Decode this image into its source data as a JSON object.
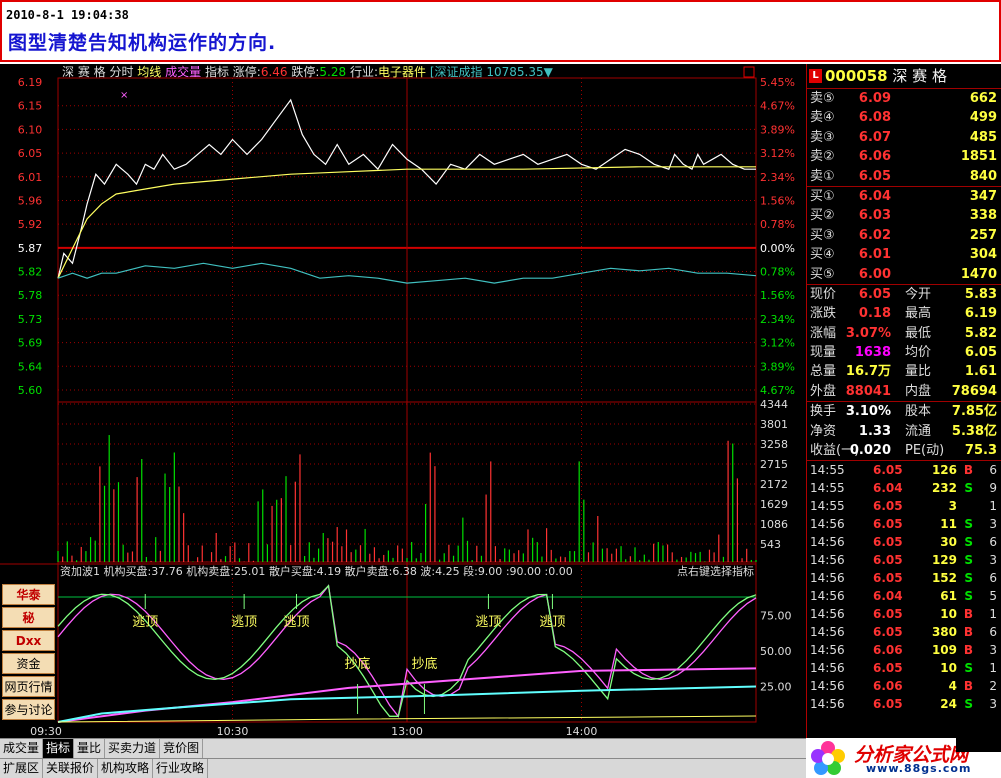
{
  "header": {
    "datetime": "2010-8-1 19:04:38",
    "caption": "图型清楚告知机构运作的方向."
  },
  "chart_header": {
    "stock_name": "深 赛 格",
    "modes": [
      "分时",
      "均线",
      "成交量",
      "指标"
    ],
    "limit_up_label": "涨停:",
    "limit_up_value": "6.46",
    "limit_down_label": "跌停:",
    "limit_down_value": "5.28",
    "industry_label": "行业:",
    "industry_value": "电子器件",
    "index_name": "[深证成指",
    "index_value": "10785.35",
    "index_arrow": "▼"
  },
  "chart_data": [
    {
      "type": "line",
      "title": "分时",
      "x_ticks": [
        "09:30",
        "10:30",
        "13:00",
        "14:00"
      ],
      "y_left": [
        "6.19",
        "6.15",
        "6.10",
        "6.05",
        "6.01",
        "5.96",
        "5.92",
        "5.87",
        "5.82",
        "5.78",
        "5.73",
        "5.69",
        "5.64",
        "5.60"
      ],
      "y_right": [
        "5.45%",
        "4.67%",
        "3.89%",
        "3.12%",
        "2.34%",
        "1.56%",
        "0.78%",
        "0.00%",
        "0.78%",
        "1.56%",
        "2.34%",
        "3.12%",
        "3.89%",
        "4.67%"
      ],
      "prev_close": 5.87,
      "ylim": [
        5.58,
        6.21
      ],
      "series": [
        {
          "name": "price",
          "color": "#ffffff",
          "x": [
            0,
            2,
            5,
            8,
            10,
            13,
            16,
            20,
            24,
            27,
            30,
            33,
            36,
            40,
            44,
            48,
            52,
            56,
            60,
            65,
            70,
            75,
            80,
            84,
            88,
            92,
            96,
            100,
            105,
            110,
            115,
            120,
            125,
            130,
            135,
            140,
            145,
            150,
            155,
            160,
            165,
            170,
            175,
            180,
            185,
            190,
            195,
            200,
            205,
            210,
            212,
            215,
            218,
            220,
            222,
            225,
            228,
            232,
            236,
            240
          ],
          "y": [
            5.83,
            5.88,
            5.86,
            5.93,
            5.98,
            6.04,
            6.02,
            6.06,
            6.04,
            6.02,
            6.06,
            6.05,
            6.08,
            6.05,
            6.06,
            6.08,
            6.1,
            6.08,
            6.11,
            6.08,
            6.11,
            6.15,
            6.19,
            6.12,
            6.08,
            6.06,
            6.1,
            6.06,
            6.08,
            6.05,
            6.1,
            6.07,
            6.05,
            6.02,
            6.06,
            6.05,
            6.08,
            6.06,
            6.07,
            6.08,
            6.06,
            6.07,
            6.08,
            6.06,
            6.05,
            6.07,
            6.09,
            6.08,
            6.06,
            6.05,
            6.08,
            6.06,
            6.05,
            6.08,
            6.06,
            6.07,
            6.08,
            6.06,
            6.05,
            6.05
          ]
        },
        {
          "name": "avg",
          "color": "#ffff60",
          "x": [
            0,
            5,
            10,
            15,
            20,
            30,
            40,
            60,
            80,
            100,
            120,
            160,
            200,
            240
          ],
          "y": [
            5.83,
            5.89,
            5.95,
            5.98,
            6.0,
            6.01,
            6.02,
            6.03,
            6.04,
            6.045,
            6.05,
            6.05,
            6.055,
            6.055
          ]
        },
        {
          "name": "index",
          "color": "#40c0c0",
          "x": [
            0,
            5,
            10,
            15,
            20,
            30,
            40,
            50,
            60,
            70,
            80,
            90,
            100,
            110,
            120,
            130,
            140,
            150,
            160,
            170,
            180,
            190,
            200,
            210,
            220,
            230,
            240
          ],
          "y": [
            5.83,
            5.84,
            5.83,
            5.84,
            5.84,
            5.855,
            5.85,
            5.86,
            5.85,
            5.86,
            5.85,
            5.83,
            5.835,
            5.83,
            5.82,
            5.825,
            5.83,
            5.82,
            5.83,
            5.83,
            5.84,
            5.85,
            5.845,
            5.85,
            5.84,
            5.84,
            5.835
          ]
        }
      ]
    },
    {
      "type": "bar",
      "title": "成交量",
      "y_right": [
        "4344",
        "3801",
        "3258",
        "2715",
        "2172",
        "1629",
        "1086",
        "543"
      ],
      "ylim": [
        0,
        4344
      ]
    },
    {
      "type": "line",
      "title": "资加波1",
      "indicator_label": "资加波1",
      "indicator_values": [
        {
          "label": "机构买盘:",
          "value": "37.76"
        },
        {
          "label": "机构卖盘:",
          "value": "25.01"
        },
        {
          "label": "散户买盘:",
          "value": "4.19"
        },
        {
          "label": "散户卖盘:",
          "value": "6.38"
        },
        {
          "label": "波:",
          "value": "4.25"
        },
        {
          "label": "段:",
          "value": "9.00"
        },
        {
          "label": ":",
          "value": "90.00"
        },
        {
          "label": ":",
          "value": "0.00"
        }
      ],
      "hint": "点右键选择指标",
      "y_right": [
        "75.00",
        "50.00",
        "25.00"
      ],
      "ylim": [
        0,
        100
      ],
      "annotations": [
        "逃顶",
        "逃顶",
        "逃顶",
        "抄底",
        "抄底",
        "逃顶",
        "逃顶"
      ]
    }
  ],
  "side_buttons": [
    "华泰",
    "秘",
    "Dxx",
    "资金",
    "网页行情",
    "参与讨论"
  ],
  "quote": {
    "badge": "L",
    "code": "000058",
    "name": "深 赛 格",
    "asks": [
      {
        "label": "卖⑤",
        "price": "6.09",
        "vol": "662"
      },
      {
        "label": "卖④",
        "price": "6.08",
        "vol": "499"
      },
      {
        "label": "卖③",
        "price": "6.07",
        "vol": "485"
      },
      {
        "label": "卖②",
        "price": "6.06",
        "vol": "1851"
      },
      {
        "label": "卖①",
        "price": "6.05",
        "vol": "840"
      }
    ],
    "bids": [
      {
        "label": "买①",
        "price": "6.04",
        "vol": "347"
      },
      {
        "label": "买②",
        "price": "6.03",
        "vol": "338"
      },
      {
        "label": "买③",
        "price": "6.02",
        "vol": "257"
      },
      {
        "label": "买④",
        "price": "6.01",
        "vol": "304"
      },
      {
        "label": "买⑤",
        "price": "6.00",
        "vol": "1470"
      }
    ],
    "stats": [
      {
        "l1": "现价",
        "v1": "6.05",
        "c1": "red",
        "l2": "今开",
        "v2": "5.83",
        "c2": "grn"
      },
      {
        "l1": "涨跌",
        "v1": "0.18",
        "c1": "red",
        "l2": "最高",
        "v2": "6.19",
        "c2": "red"
      },
      {
        "l1": "涨幅",
        "v1": "3.07%",
        "c1": "red",
        "l2": "最低",
        "v2": "5.82",
        "c2": "grn"
      },
      {
        "l1": "现量",
        "v1": "1638",
        "c1": "mag",
        "l2": "均价",
        "v2": "6.05",
        "c2": "red"
      },
      {
        "l1": "总量",
        "v1": "16.7万",
        "c1": "yel",
        "l2": "量比",
        "v2": "1.61",
        "c2": "red"
      },
      {
        "l1": "外盘",
        "v1": "88041",
        "c1": "red",
        "l2": "内盘",
        "v2": "78694",
        "c2": "grn"
      }
    ],
    "stats2": [
      {
        "l1": "换手",
        "v1": "3.10%",
        "l2": "股本",
        "v2": "7.85亿"
      },
      {
        "l1": "净资",
        "v1": "1.33",
        "l2": "流通",
        "v2": "5.38亿"
      },
      {
        "l1": "收益(一)",
        "v1": "0.020",
        "l2": "PE(动)",
        "v2": "75.3"
      }
    ],
    "ticks": [
      {
        "t": "14:55",
        "p": "6.05",
        "pc": "red",
        "v": "126",
        "bs": "B",
        "bc": "red",
        "n": "6"
      },
      {
        "t": "14:55",
        "p": "6.04",
        "pc": "red",
        "v": "232",
        "bs": "S",
        "bc": "grn",
        "n": "9"
      },
      {
        "t": "14:55",
        "p": "6.05",
        "pc": "red",
        "v": "3",
        "bs": "",
        "bc": "wht",
        "n": "1"
      },
      {
        "t": "14:56",
        "p": "6.05",
        "pc": "red",
        "v": "11",
        "bs": "S",
        "bc": "grn",
        "n": "3"
      },
      {
        "t": "14:56",
        "p": "6.05",
        "pc": "red",
        "v": "30",
        "bs": "S",
        "bc": "grn",
        "n": "6"
      },
      {
        "t": "14:56",
        "p": "6.05",
        "pc": "red",
        "v": "129",
        "bs": "S",
        "bc": "grn",
        "n": "3"
      },
      {
        "t": "14:56",
        "p": "6.05",
        "pc": "red",
        "v": "152",
        "bs": "S",
        "bc": "grn",
        "n": "6"
      },
      {
        "t": "14:56",
        "p": "6.04",
        "pc": "red",
        "v": "61",
        "bs": "S",
        "bc": "grn",
        "n": "5"
      },
      {
        "t": "14:56",
        "p": "6.05",
        "pc": "red",
        "v": "10",
        "bs": "B",
        "bc": "red",
        "n": "1"
      },
      {
        "t": "14:56",
        "p": "6.05",
        "pc": "red",
        "v": "380",
        "bs": "B",
        "bc": "red",
        "n": "6"
      },
      {
        "t": "14:56",
        "p": "6.06",
        "pc": "red",
        "v": "109",
        "bs": "B",
        "bc": "red",
        "n": "3"
      },
      {
        "t": "14:56",
        "p": "6.05",
        "pc": "red",
        "v": "10",
        "bs": "S",
        "bc": "grn",
        "n": "1"
      },
      {
        "t": "14:56",
        "p": "6.06",
        "pc": "red",
        "v": "4",
        "bs": "B",
        "bc": "red",
        "n": "2"
      },
      {
        "t": "14:56",
        "p": "6.05",
        "pc": "red",
        "v": "24",
        "bs": "S",
        "bc": "grn",
        "n": "3"
      }
    ]
  },
  "tabs_row1": [
    "成交量",
    "指标",
    "量比",
    "买卖力道",
    "竞价图"
  ],
  "tabs_row1_active": 1,
  "tabs_row2": [
    "扩展区",
    "关联报价",
    "机构攻略",
    "行业攻略"
  ],
  "brand": {
    "name": "分析家公式网",
    "url": "www.88gs.com"
  },
  "colors": {
    "up": "#ff3232",
    "down": "#00e000",
    "grid": "#a00000",
    "price_line": "#ffffff",
    "avg_line": "#ffff60"
  }
}
